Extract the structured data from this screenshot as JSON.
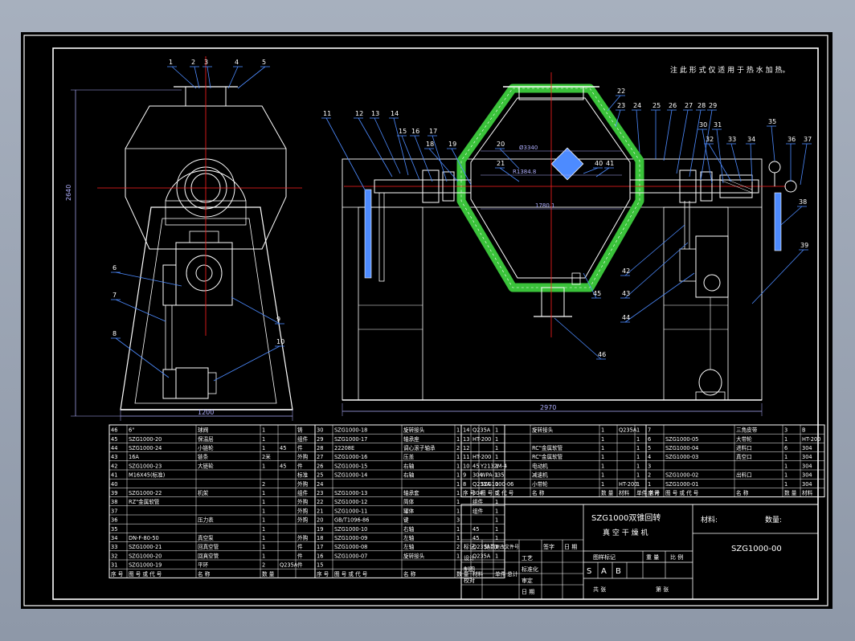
{
  "colors": {
    "background": "#000000",
    "frame": "#ffffff",
    "centerline": "#ff2020",
    "leader": "#4d8bff",
    "jacket": "#3ac23a",
    "structure": "#ffffff",
    "dimension": "#b0b0ff"
  },
  "notes": {
    "top_note": "注 此 形 式 仅 适 用 于 热 水 加 热。"
  },
  "dimensions": {
    "left_height": "2640",
    "left_width": "1200",
    "right_width": "2970",
    "inner_1": "Ø3340",
    "inner_2": "R1384.8",
    "inner_3": "1780.1"
  },
  "balloons_left": [
    "1",
    "2",
    "3",
    "4",
    "5",
    "6",
    "7",
    "8",
    "9",
    "10"
  ],
  "balloons_right": [
    "11",
    "12",
    "13",
    "14",
    "15",
    "16",
    "17",
    "18",
    "19",
    "20",
    "21",
    "22",
    "23",
    "24",
    "25",
    "26",
    "27",
    "28",
    "29",
    "30",
    "31",
    "32",
    "33",
    "34",
    "35",
    "36",
    "37",
    "38",
    "39",
    "40",
    "41",
    "42",
    "43",
    "44",
    "45",
    "46"
  ],
  "bom": {
    "col1": [
      [
        "46",
        "6\"",
        "球阀",
        "1",
        "",
        "铸"
      ],
      [
        "45",
        "SZG1000-20",
        "保温层",
        "1",
        "",
        "组件"
      ],
      [
        "44",
        "SZG1000-24",
        "小链轮",
        "1",
        "45",
        "件"
      ],
      [
        "43",
        "16A",
        "链条",
        "2米",
        "",
        "外购"
      ],
      [
        "42",
        "SZG1000-23",
        "大链轮",
        "1",
        "45",
        "件"
      ],
      [
        "41",
        "M16X45(标准)",
        "",
        "",
        "",
        "标准"
      ],
      [
        "40",
        "",
        "",
        "2",
        "",
        "外购"
      ],
      [
        "39",
        "SZG1000-22",
        "机架",
        "1",
        "",
        "组件"
      ],
      [
        "38",
        "RZ\"金属软管",
        "",
        "1",
        "",
        "外购"
      ],
      [
        "37",
        "",
        "",
        "1",
        "",
        "外购"
      ],
      [
        "36",
        "",
        "压力表",
        "1",
        "",
        "外购"
      ],
      [
        "35",
        "",
        "",
        "1",
        "",
        ""
      ],
      [
        "34",
        "DN-F-80-50",
        "真空泵",
        "1",
        "",
        "外购"
      ],
      [
        "33",
        "SZG1000-21",
        "回真空管",
        "1",
        "",
        "件"
      ],
      [
        "32",
        "SZG1000-20",
        "回真空管",
        "1",
        "",
        "件"
      ],
      [
        "31",
        "SZG1000-19",
        "平环",
        "2",
        "Q235A",
        "件"
      ]
    ],
    "col1_footer": [
      "序 号",
      "图 号 或 代 号",
      "名 称",
      "数 量",
      "",
      ""
    ],
    "col2": [
      [
        "30",
        "SZG1000-18",
        "旋转接头",
        "1",
        "Q235A",
        "1"
      ],
      [
        "29",
        "SZG1000-17",
        "轴承座",
        "1",
        "HT-200",
        "1"
      ],
      [
        "28",
        "22208E",
        "调心滚子轴承",
        "2",
        "",
        "1"
      ],
      [
        "27",
        "SZG1000-16",
        "压盖",
        "1",
        "HT-200",
        "1"
      ],
      [
        "26",
        "SZG1000-15",
        "右轴",
        "1",
        "45",
        "1"
      ],
      [
        "25",
        "SZG1000-14",
        "右轴",
        "1",
        "304",
        "1"
      ],
      [
        "24",
        "",
        "",
        "1",
        "Q235A",
        "1"
      ],
      [
        "23",
        "SZG1000-13",
        "轴承套",
        "1",
        "304",
        "1"
      ],
      [
        "22",
        "SZG1000-12",
        "简体",
        "1",
        "组件",
        "1"
      ],
      [
        "21",
        "SZG1000-11",
        "罐体",
        "1",
        "组件",
        "1"
      ],
      [
        "20",
        "GB/T1096-86",
        "键",
        "3",
        "",
        "1"
      ],
      [
        "19",
        "SZG1000-10",
        "右轴",
        "1",
        "45",
        "1"
      ],
      [
        "18",
        "SZG1000-09",
        "左轴",
        "1",
        "45",
        "1"
      ],
      [
        "17",
        "SZG1000-08",
        "左轴",
        "2",
        "Q235A",
        "1"
      ],
      [
        "16",
        "SZG1000-07",
        "旋转接头",
        "1",
        "Q235A",
        "1"
      ],
      [
        "15",
        "",
        "",
        "",
        "",
        ""
      ]
    ],
    "col2_footer": [
      "序 号",
      "图 号 或 代 号",
      "名 称",
      "数 量",
      "材料",
      "单件 总计"
    ],
    "col3": [
      [
        "14",
        "",
        "旋转接头",
        "1",
        "Q235A",
        "1"
      ],
      [
        "13",
        "",
        "",
        "1",
        "",
        "1"
      ],
      [
        "12",
        "",
        "RC\"金属软管",
        "1",
        "",
        "1"
      ],
      [
        "11",
        "",
        "RC\"金属软管",
        "1",
        "",
        "1"
      ],
      [
        "10",
        "Y2132M-4",
        "电动机",
        "1",
        "",
        "1"
      ],
      [
        "9",
        "WPA-135",
        "减速机",
        "1",
        "",
        "1"
      ],
      [
        "8",
        "SZG1000-06",
        "小带轮",
        "1",
        "HT-200",
        "1"
      ]
    ],
    "col3_footer": [
      "序 号",
      "图 号 或 代 号",
      "名 称",
      "数 量",
      "材料",
      "单件 总计"
    ],
    "col4": [
      [
        "7",
        "",
        "三角皮带",
        "3",
        "B"
      ],
      [
        "6",
        "SZG1000-05",
        "大带轮",
        "1",
        "HT-200"
      ],
      [
        "5",
        "SZG1000-04",
        "进料口",
        "6",
        "304"
      ],
      [
        "4",
        "SZG1000-03",
        "真空口",
        "1",
        "304"
      ],
      [
        "3",
        "",
        "",
        "1",
        "304"
      ],
      [
        "2",
        "SZG1000-02",
        "出料口",
        "1",
        "304"
      ],
      [
        "1",
        "SZG1000-01",
        "",
        "1",
        "304"
      ]
    ],
    "col4_footer": [
      "序 号",
      "图 号 或 代 号",
      "名 称",
      "数 量",
      "材料"
    ]
  },
  "title_block": {
    "product_line1": "SZG1000双锥回转",
    "product_line2": "真 空 干 燥 机",
    "material_label": "材料:",
    "quantity_label": "数量:",
    "drawing_no": "SZG1000-00",
    "stage_label": "图样标记",
    "weight_label": "重 量",
    "scale_label": "比 例",
    "stage_s": "S",
    "stage_a": "A",
    "stage_b": "B",
    "sheet_total": "共  张",
    "sheet_no": "第  张",
    "mark_label": "标记",
    "count_label": "处数",
    "change_label": "更改文件号",
    "sign_label": "签字",
    "date_label": "日 期",
    "design_label": "设计",
    "draw_label": "制图",
    "check_label": "校对",
    "craft_label": "工艺",
    "std_label": "标准化",
    "approve_label": "审定",
    "date2_label": "日 期"
  }
}
